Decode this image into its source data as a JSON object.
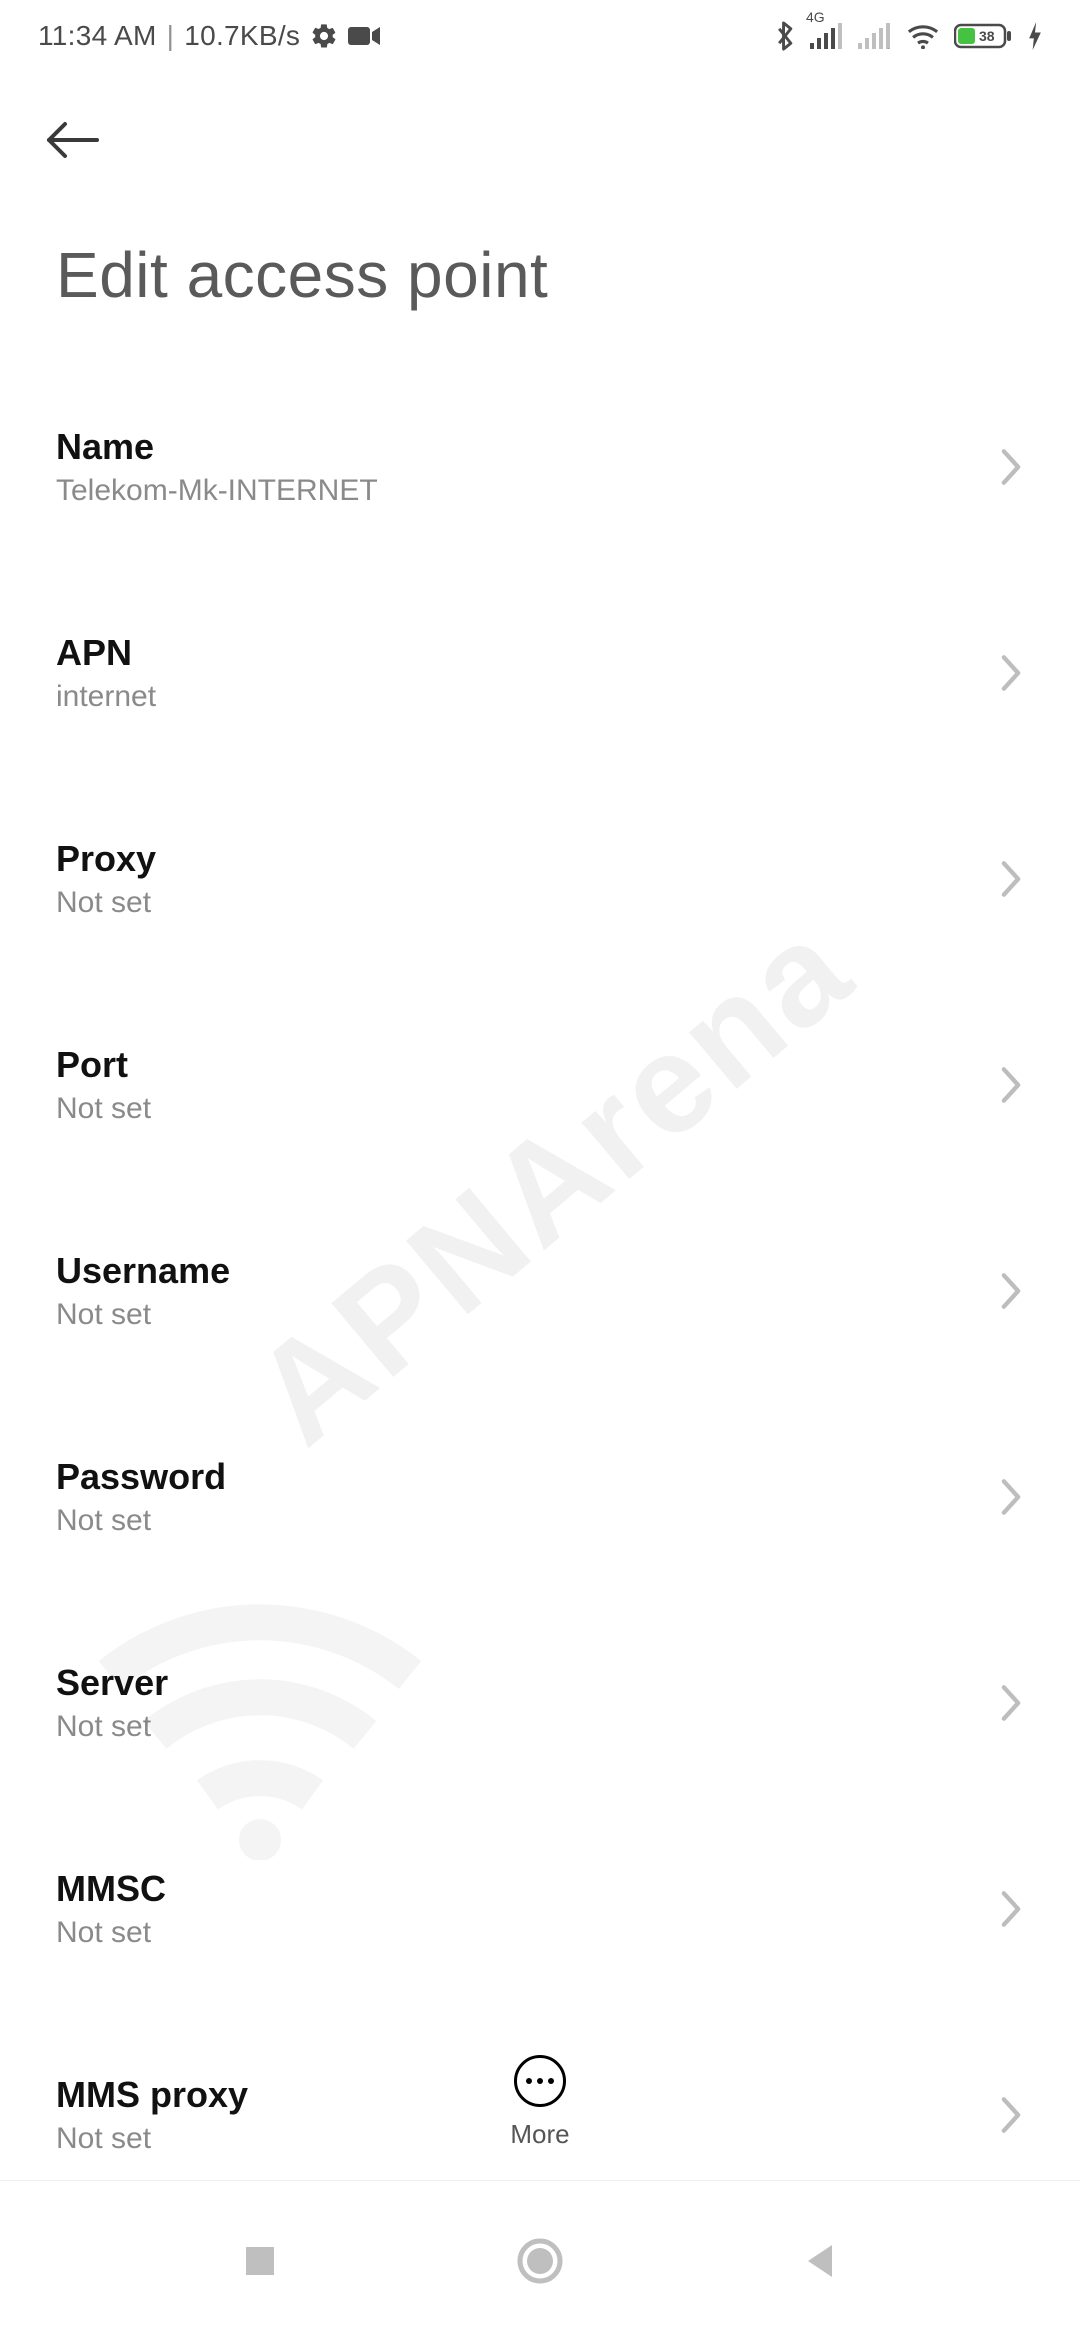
{
  "status": {
    "time": "11:34 AM",
    "net_speed": "10.7KB/s",
    "network_badge": "4G",
    "battery_pct": "38"
  },
  "header": {
    "title": "Edit access point"
  },
  "rows": [
    {
      "label": "Name",
      "value": "Telekom-Mk-INTERNET"
    },
    {
      "label": "APN",
      "value": "internet"
    },
    {
      "label": "Proxy",
      "value": "Not set"
    },
    {
      "label": "Port",
      "value": "Not set"
    },
    {
      "label": "Username",
      "value": "Not set"
    },
    {
      "label": "Password",
      "value": "Not set"
    },
    {
      "label": "Server",
      "value": "Not set"
    },
    {
      "label": "MMSC",
      "value": "Not set"
    },
    {
      "label": "MMS proxy",
      "value": "Not set"
    }
  ],
  "bottom": {
    "more_label": "More"
  },
  "watermark": "APNArena"
}
